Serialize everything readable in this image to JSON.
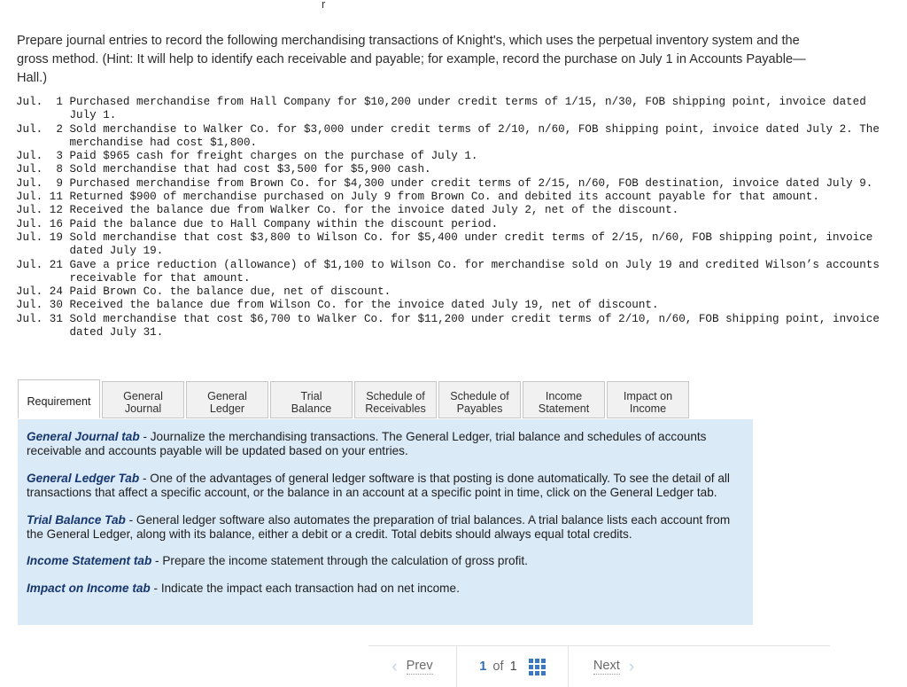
{
  "top_fragment": "r",
  "intro": {
    "text": "Prepare journal entries to record the following merchandising transactions of Knight's, which uses the perpetual inventory system and the gross method. (Hint: It will help to identify each receivable and payable; for example, record the purchase on July 1 in Accounts Payable—Hall.)"
  },
  "transactions": [
    "Jul.  1 Purchased merchandise from Hall Company for $10,200 under credit terms of 1/15, n/30, FOB shipping point, invoice dated\n        July 1.",
    "Jul.  2 Sold merchandise to Walker Co. for $3,000 under credit terms of 2/10, n/60, FOB shipping point, invoice dated July 2. The\n        merchandise had cost $1,800.",
    "Jul.  3 Paid $965 cash for freight charges on the purchase of July 1.",
    "Jul.  8 Sold merchandise that had cost $3,500 for $5,900 cash.",
    "Jul.  9 Purchased merchandise from Brown Co. for $4,300 under credit terms of 2/15, n/60, FOB destination, invoice dated July 9.",
    "Jul. 11 Returned $900 of merchandise purchased on July 9 from Brown Co. and debited its account payable for that amount.",
    "Jul. 12 Received the balance due from Walker Co. for the invoice dated July 2, net of the discount.",
    "Jul. 16 Paid the balance due to Hall Company within the discount period.",
    "Jul. 19 Sold merchandise that cost $3,800 to Wilson Co. for $5,400 under credit terms of 2/15, n/60, FOB shipping point, invoice\n        dated July 19.",
    "Jul. 21 Gave a price reduction (allowance) of $1,100 to Wilson Co. for merchandise sold on July 19 and credited Wilson’s accounts\n        receivable for that amount.",
    "Jul. 24 Paid Brown Co. the balance due, net of discount.",
    "Jul. 30 Received the balance due from Wilson Co. for the invoice dated July 19, net of discount.",
    "Jul. 31 Sold merchandise that cost $6,700 to Walker Co. for $11,200 under credit terms of 2/10, n/60, FOB shipping point, invoice\n        dated July 31."
  ],
  "tabs": [
    {
      "label_line1": "Requirement",
      "label_line2": "",
      "active": true,
      "width_class": "tab-w-req"
    },
    {
      "label_line1": "General",
      "label_line2": "Journal",
      "active": false,
      "width_class": "tab-w-gj"
    },
    {
      "label_line1": "General",
      "label_line2": "Ledger",
      "active": false,
      "width_class": "tab-w-gl"
    },
    {
      "label_line1": "Trial Balance",
      "label_line2": "",
      "active": false,
      "width_class": "tab-w-tb"
    },
    {
      "label_line1": "Schedule of",
      "label_line2": "Receivables",
      "active": false,
      "width_class": "tab-w-sr"
    },
    {
      "label_line1": "Schedule of",
      "label_line2": "Payables",
      "active": false,
      "width_class": "tab-w-sp"
    },
    {
      "label_line1": "Income",
      "label_line2": "Statement",
      "active": false,
      "width_class": "tab-w-is"
    },
    {
      "label_line1": "Impact on",
      "label_line2": "Income",
      "active": false,
      "width_class": "tab-w-ii"
    }
  ],
  "panel": {
    "paragraphs": [
      {
        "head": "General Journal tab",
        "body": " - Journalize the merchandising transactions. The General Ledger, trial balance and schedules of accounts receivable and accounts payable will be updated based on your entries."
      },
      {
        "head": "General Ledger Tab",
        "body": " - One of the advantages of general ledger software is that posting is done automatically. To see the detail of all transactions that affect a specific account, or the balance in an account at a specific point in time, click on the General Ledger tab."
      },
      {
        "head": "Trial Balance Tab",
        "body": " - General ledger software also automates the preparation of trial balances. A trial balance lists each account from the General Ledger, along with its balance, either a debit or a credit. Total debits should always equal total credits."
      },
      {
        "head": "Income Statement tab",
        "body": " - Prepare the income statement through the calculation of gross profit."
      },
      {
        "head": "Impact on Income tab",
        "body": " - Indicate the impact each transaction had on net income."
      }
    ]
  },
  "pager": {
    "prev_label": "Prev",
    "next_label": "Next",
    "current_page": "1",
    "of_label": "of",
    "total_pages": "1",
    "prev_chevron": "‹",
    "next_chevron": "›"
  },
  "colors": {
    "panel_background": "#dbeaf7",
    "panel_heading": "#15366e",
    "tab_inactive_background": "#f1f1f1",
    "tab_border": "#c6c6c6",
    "pager_accent": "#2f6fb5",
    "grid_icon": "#3a78c2"
  }
}
